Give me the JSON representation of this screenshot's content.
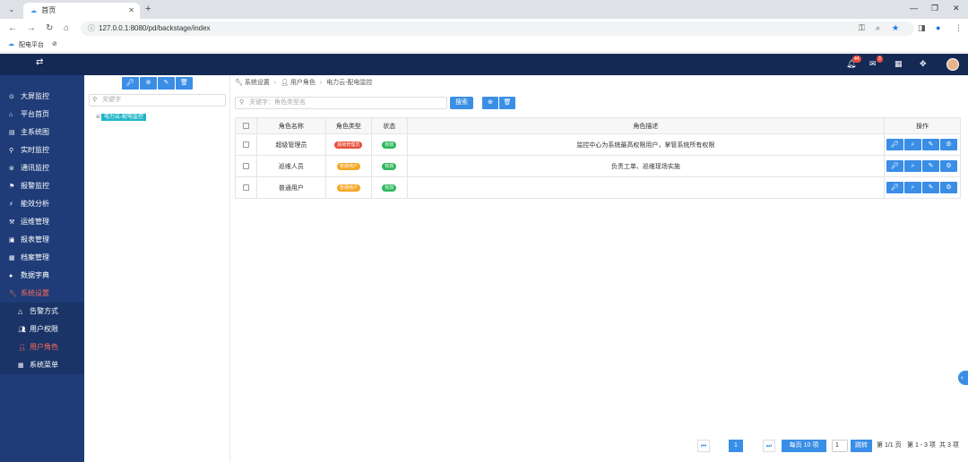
{
  "browser": {
    "tab_title": "首页",
    "url": "127.0.0.1:8080/pd/backstage/index",
    "bookmark": "配电平台"
  },
  "topbar": {
    "notif_badge": "44",
    "mail_badge": "3"
  },
  "sidebar": {
    "items": [
      {
        "label": "大屏监控",
        "icon": "monitor-icon"
      },
      {
        "label": "平台首页",
        "icon": "home-icon"
      },
      {
        "label": "主系统图",
        "icon": "diagram-icon"
      },
      {
        "label": "实时监控",
        "icon": "location-icon"
      },
      {
        "label": "通讯监控",
        "icon": "signal-icon"
      },
      {
        "label": "报警监控",
        "icon": "flag-icon"
      },
      {
        "label": "能效分析",
        "icon": "bolt-icon"
      },
      {
        "label": "运维管理",
        "icon": "tools-icon"
      },
      {
        "label": "报表管理",
        "icon": "report-icon"
      },
      {
        "label": "档案管理",
        "icon": "archive-icon"
      },
      {
        "label": "数据字典",
        "icon": "book-icon"
      },
      {
        "label": "系统设置",
        "icon": "wrench-icon"
      }
    ],
    "sub_items": [
      {
        "label": "告警方式",
        "icon": "bell-icon"
      },
      {
        "label": "用户权限",
        "icon": "users-icon"
      },
      {
        "label": "用户角色",
        "icon": "user-icon"
      },
      {
        "label": "系统菜单",
        "icon": "grid-icon"
      }
    ]
  },
  "tree": {
    "search_placeholder": "关键字",
    "node": "电力云-配电监控"
  },
  "main": {
    "breadcrumb": [
      "系统设置",
      "用户角色",
      "电力云-配电监控"
    ],
    "search_placeholder": "关键字：角色类型名",
    "search_button": "搜索",
    "columns": [
      "角色名称",
      "角色类型",
      "状态",
      "角色描述",
      "操作"
    ],
    "rows": [
      {
        "name": "超级管理员",
        "type": "超级管理员",
        "type_color": "red",
        "status": "有效",
        "desc": "监控中心为系统最高权限用户，掌管系统所有权限"
      },
      {
        "name": "巡维人员",
        "type": "普通用户",
        "type_color": "orange",
        "status": "有效",
        "desc": "负责工单、巡维现场实施"
      },
      {
        "name": "普通用户",
        "type": "普通用户",
        "type_color": "orange",
        "status": "有效",
        "desc": ""
      }
    ]
  },
  "pager": {
    "current_page": "1",
    "page_size": "每页 10 项",
    "jump_value": "1",
    "jump_button": "跳转",
    "page_info": "第 1/1 页",
    "item_info": "第 1 - 3 项",
    "total": "共 3 项"
  },
  "colors": {
    "topnav": "#142a55",
    "sidebar": "#1f3c78",
    "primary": "#3a8ee6",
    "active_menu": "#ff6b5a"
  }
}
